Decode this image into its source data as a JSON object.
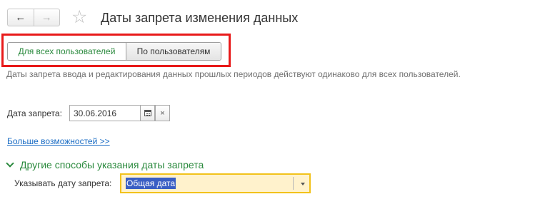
{
  "header": {
    "back_icon": "arrow-left-icon",
    "forward_icon": "arrow-right-icon",
    "favorite_icon": "star-icon",
    "title": "Даты запрета изменения данных"
  },
  "mode_switch": {
    "options": [
      "Для всех пользователей",
      "По пользователям"
    ],
    "selected": "Для всех пользователей"
  },
  "info_text": "Даты запрета ввода и редактирования данных прошлых периодов действуют одинаково для всех пользователей.",
  "date_field": {
    "label": "Дата запрета:",
    "value": "30.06.2016",
    "calendar_icon": "calendar-icon",
    "clear_glyph": "×"
  },
  "more_link": "Больше возможностей >>",
  "other_methods_group": {
    "title": "Другие способы указания даты запрета",
    "expanded": true,
    "specify_label": "Указывать дату запрета:",
    "specify_value": "Общая дата"
  },
  "colors": {
    "accent_green": "#2b8a3e",
    "highlight_red": "#e81a1a",
    "link_blue": "#1a6cc4",
    "field_focus_yellow": "#f2c21b"
  }
}
